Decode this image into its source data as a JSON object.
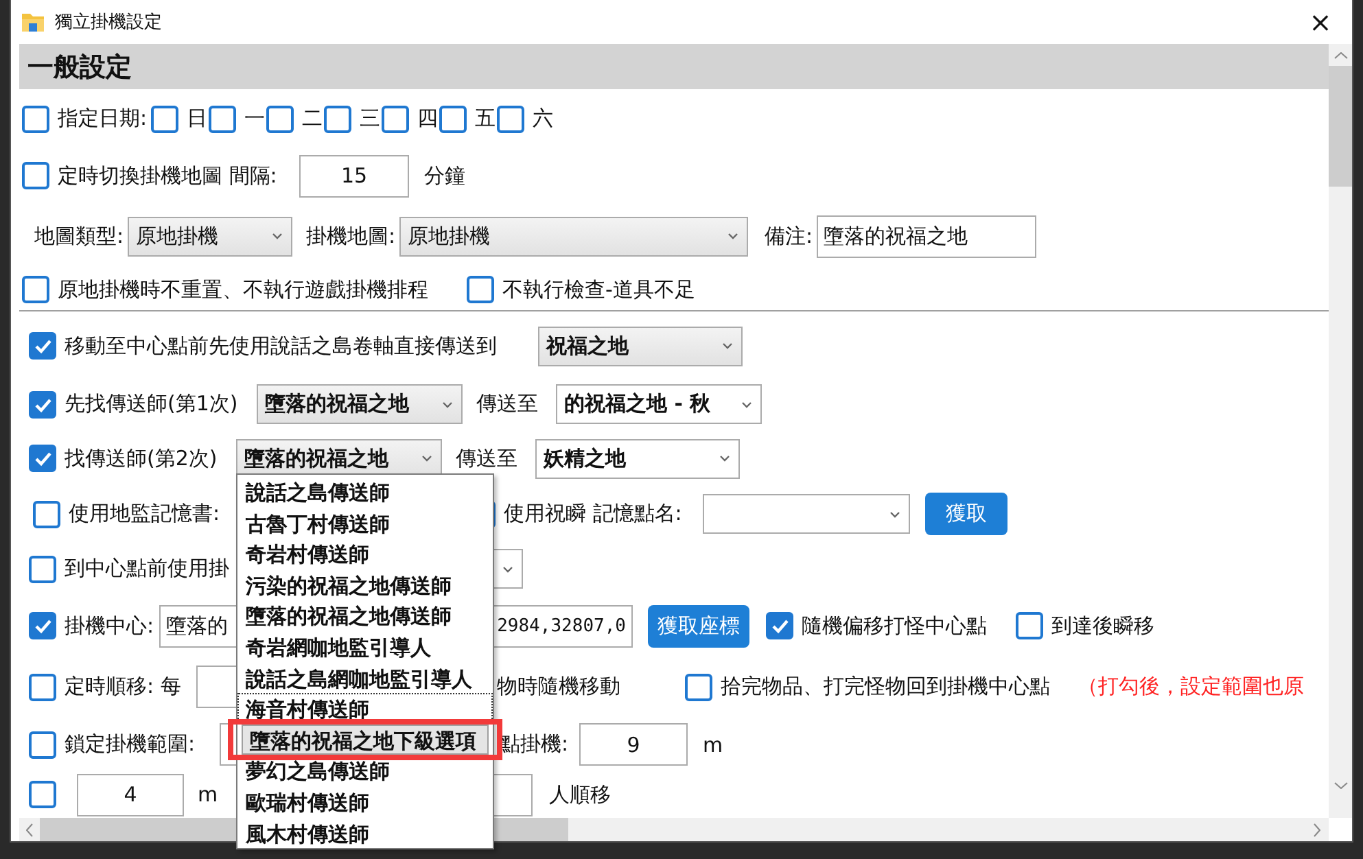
{
  "window": {
    "title": "獨立掛機設定",
    "close": "×"
  },
  "section": {
    "title": "一般設定"
  },
  "rows": [
    {
      "items": [
        {
          "kind": "check",
          "label": "指定日期:",
          "checked": false
        },
        {
          "kind": "check",
          "label": "日",
          "checked": false
        },
        {
          "kind": "check",
          "label": "一",
          "checked": false
        },
        {
          "kind": "check",
          "label": "二",
          "checked": false
        },
        {
          "kind": "check",
          "label": "三",
          "checked": false
        },
        {
          "kind": "check",
          "label": "四",
          "checked": false
        },
        {
          "kind": "check",
          "label": "五",
          "checked": false
        },
        {
          "kind": "check",
          "label": "六",
          "checked": false
        }
      ]
    },
    {
      "items": [
        {
          "kind": "check",
          "label": "定時切換掛機地圖 間隔:",
          "checked": false
        },
        {
          "kind": "field",
          "value": "15"
        },
        {
          "kind": "label",
          "text": "分鐘"
        }
      ]
    },
    {
      "items": [
        {
          "kind": "label",
          "text": "地圖類型:"
        },
        {
          "kind": "select",
          "value": "原地掛機"
        },
        {
          "kind": "label",
          "text": "掛機地圖:"
        },
        {
          "kind": "select",
          "value": "原地掛機"
        },
        {
          "kind": "label",
          "text": "備注:"
        },
        {
          "kind": "field",
          "value": "墮落的祝福之地"
        }
      ]
    },
    {
      "items": [
        {
          "kind": "check",
          "label": "原地掛機時不重置、不執行遊戲掛機排程",
          "checked": false
        },
        {
          "kind": "check",
          "label": "不執行檢查-道具不足",
          "checked": false
        }
      ]
    },
    {
      "items": [
        {
          "kind": "check",
          "label": "移動至中心點前先使用說話之島卷軸直接傳送到",
          "checked": true
        },
        {
          "kind": "select",
          "value": "祝福之地"
        }
      ]
    },
    {
      "items": [
        {
          "kind": "check",
          "label": "先找傳送師(第1次)",
          "checked": true
        },
        {
          "kind": "select",
          "value": "墮落的祝福之地"
        },
        {
          "kind": "label",
          "text": "傳送至"
        },
        {
          "kind": "select",
          "value": "的祝福之地 - 秋"
        }
      ]
    },
    {
      "items": [
        {
          "kind": "check",
          "label": "找傳送師(第2次)",
          "checked": true
        },
        {
          "kind": "select",
          "value": "墮落的祝福之地"
        },
        {
          "kind": "label",
          "text": "傳送至"
        },
        {
          "kind": "select",
          "value": "妖精之地"
        }
      ]
    },
    {
      "items": [
        {
          "kind": "check",
          "label": "使用地監記憶書:",
          "checked": false
        },
        {
          "kind": "check",
          "label": "使用祝瞬 記憶點名:",
          "checked": false
        },
        {
          "kind": "select"
        },
        {
          "kind": "button",
          "label": "獲取"
        }
      ]
    },
    {
      "items": [
        {
          "kind": "check",
          "label": "到中心點前使用掛",
          "checked": false
        },
        {
          "kind": "select"
        }
      ]
    },
    {
      "items": [
        {
          "kind": "check",
          "label": "掛機中心:",
          "checked": true
        },
        {
          "kind": "field",
          "value": "墮落的",
          "value_tail": "2984,32807,0"
        },
        {
          "kind": "button",
          "label": "獲取座標"
        },
        {
          "kind": "check",
          "label": "隨機偏移打怪中心點",
          "checked": true
        },
        {
          "kind": "check",
          "label": "到達後瞬移",
          "checked": false
        }
      ]
    },
    {
      "items": [
        {
          "kind": "check",
          "label": "定時順移: 每",
          "checked": false
        },
        {
          "kind": "field"
        },
        {
          "kind": "label",
          "text": "物時隨機移動"
        },
        {
          "kind": "check",
          "label": "拾完物品、打完怪物回到掛機中心點",
          "checked": false
        },
        {
          "kind": "note",
          "text": "（打勾後，設定範圍也原"
        }
      ]
    },
    {
      "items": [
        {
          "kind": "check",
          "label": "鎖定掛機範圍:",
          "checked": false
        },
        {
          "kind": "field"
        },
        {
          "kind": "label",
          "text": "點掛機:"
        },
        {
          "kind": "field",
          "value": "9"
        },
        {
          "kind": "label",
          "text": "m"
        }
      ]
    },
    {
      "items": [
        {
          "kind": "check",
          "checked": false
        },
        {
          "kind": "field",
          "value": "4"
        },
        {
          "kind": "label",
          "text": "m"
        },
        {
          "kind": "field"
        },
        {
          "kind": "label",
          "text": "人順移"
        }
      ]
    }
  ],
  "dropdown": {
    "items": [
      {
        "label": "說話之島傳送師",
        "selected": false,
        "focused": false,
        "highlighted": false
      },
      {
        "label": "古魯丁村傳送師",
        "selected": false,
        "focused": false,
        "highlighted": false
      },
      {
        "label": "奇岩村傳送師",
        "selected": false,
        "focused": false,
        "highlighted": false
      },
      {
        "label": "污染的祝福之地傳送師",
        "selected": false,
        "focused": false,
        "highlighted": false
      },
      {
        "label": "墮落的祝福之地傳送師",
        "selected": false,
        "focused": false,
        "highlighted": false
      },
      {
        "label": "奇岩網咖地監引導人",
        "selected": false,
        "focused": false,
        "highlighted": false
      },
      {
        "label": "說話之島網咖地監引導人",
        "selected": false,
        "focused": false,
        "highlighted": false
      },
      {
        "label": "海音村傳送師",
        "selected": false,
        "focused": true,
        "highlighted": false
      },
      {
        "label": "墮落的祝福之地下級選項",
        "selected": true,
        "focused": false,
        "highlighted": true
      },
      {
        "label": "夢幻之島傳送師",
        "selected": false,
        "focused": false,
        "highlighted": false
      },
      {
        "label": "歐瑞村傳送師",
        "selected": false,
        "focused": false,
        "highlighted": false
      },
      {
        "label": "風木村傳送師",
        "selected": false,
        "focused": false,
        "highlighted": false
      }
    ]
  }
}
